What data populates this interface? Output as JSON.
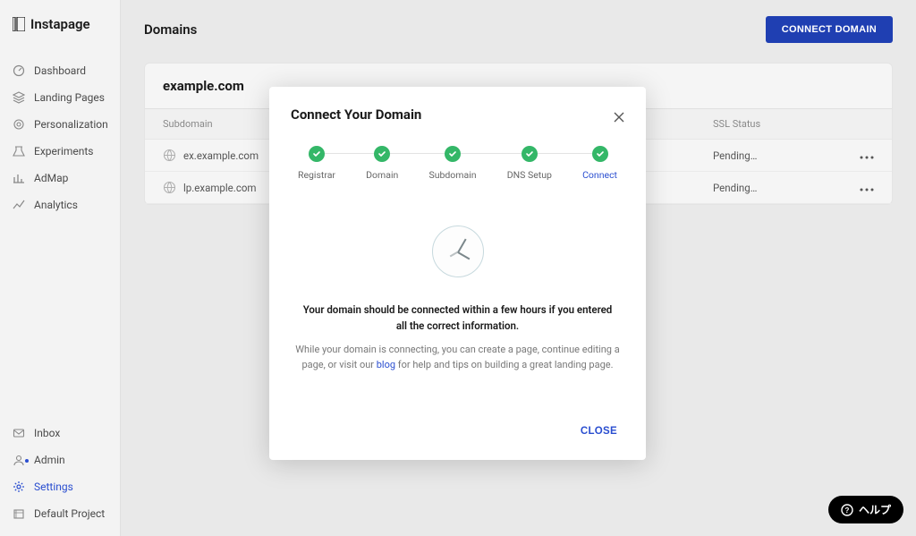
{
  "brand": "Instapage",
  "page_title": "Domains",
  "connect_button": "CONNECT DOMAIN",
  "nav": {
    "top": [
      {
        "id": "dashboard",
        "label": "Dashboard"
      },
      {
        "id": "landing-pages",
        "label": "Landing Pages"
      },
      {
        "id": "personalization",
        "label": "Personalization"
      },
      {
        "id": "experiments",
        "label": "Experiments"
      },
      {
        "id": "admap",
        "label": "AdMap"
      },
      {
        "id": "analytics",
        "label": "Analytics"
      }
    ],
    "bottom": [
      {
        "id": "inbox",
        "label": "Inbox"
      },
      {
        "id": "admin",
        "label": "Admin",
        "dot": true
      },
      {
        "id": "settings",
        "label": "Settings",
        "active": true
      },
      {
        "id": "default-project",
        "label": "Default Project"
      }
    ]
  },
  "domain_card": {
    "title": "example.com",
    "columns": {
      "subdomain": "Subdomain",
      "mid1": "",
      "mid2": "",
      "ssl": "SSL Status",
      "actions": ""
    },
    "rows": [
      {
        "subdomain": "ex.example.com",
        "ssl": "Pending…"
      },
      {
        "subdomain": "lp.example.com",
        "ssl": "Pending…"
      }
    ]
  },
  "modal": {
    "title": "Connect Your Domain",
    "steps": [
      "Registrar",
      "Domain",
      "Subdomain",
      "DNS Setup",
      "Connect"
    ],
    "active_step": 4,
    "message": "Your domain should be connected within a few hours if you entered all the correct information.",
    "subtext_pre": "While your domain is connecting, you can create a page, continue editing a page, or visit our ",
    "blog_label": "blog",
    "subtext_post": " for help and tips on building a great landing page.",
    "close_label": "CLOSE"
  },
  "help_label": "ヘルプ",
  "icons": {
    "dashboard": "dashboard-icon",
    "landing-pages": "layers-icon",
    "personalization": "target-icon",
    "experiments": "beaker-icon",
    "admap": "bars-icon",
    "analytics": "chart-icon",
    "inbox": "inbox-icon",
    "admin": "user-icon",
    "settings": "gear-icon",
    "default-project": "folder-icon"
  }
}
